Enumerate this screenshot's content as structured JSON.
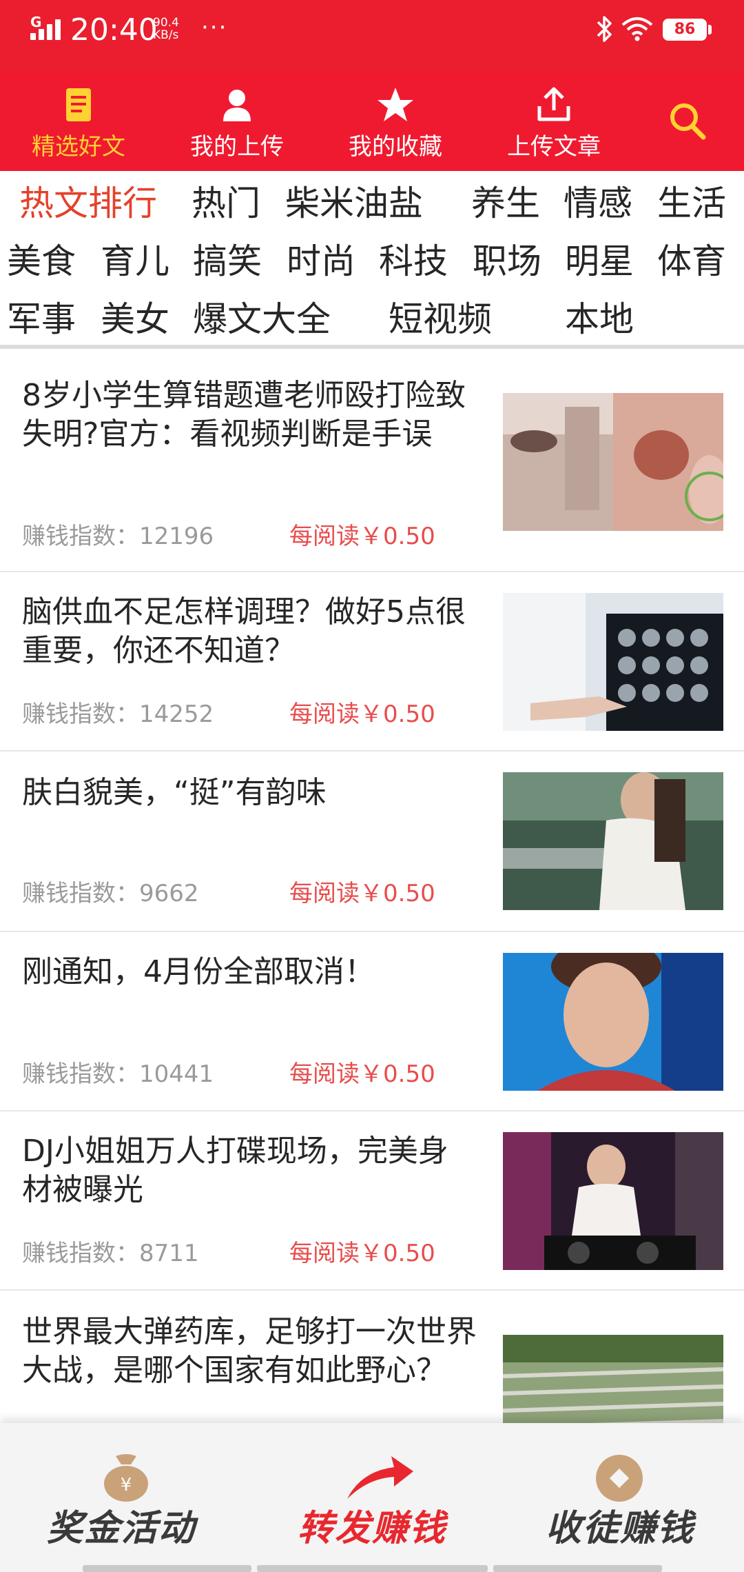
{
  "status_bar": {
    "carrier_mark": "G",
    "time": "20:40",
    "net_speed_value": "90.4",
    "net_speed_unit": "KB/s",
    "more": "···",
    "battery": "86",
    "icons": [
      "signal-icon",
      "bluetooth-icon",
      "wifi-icon",
      "battery-icon"
    ]
  },
  "top_nav": {
    "items": [
      {
        "label": "精选好文",
        "icon": "article-icon",
        "active": true
      },
      {
        "label": "我的上传",
        "icon": "user-icon",
        "active": false
      },
      {
        "label": "我的收藏",
        "icon": "star-icon",
        "active": false
      },
      {
        "label": "上传文章",
        "icon": "upload-icon",
        "active": false
      }
    ],
    "search_icon": "search-icon"
  },
  "categories": [
    "热文排行",
    "热门",
    "柴米油盐",
    "养生",
    "情感",
    "生活",
    "美食",
    "育儿",
    "搞笑",
    "时尚",
    "科技",
    "职场",
    "明星",
    "体育",
    "军事",
    "美女",
    "爆文大全",
    "短视频",
    "本地"
  ],
  "active_category": "热文排行",
  "articles": [
    {
      "title": "8岁小学生算错题遭老师殴打险致失明?官方：看视频判断是手误",
      "index_label": "赚钱指数：",
      "index_value": "12196",
      "reward": "每阅读￥0.50"
    },
    {
      "title": "脑供血不足怎样调理？做好5点很重要，你还不知道？",
      "index_label": "赚钱指数：",
      "index_value": "14252",
      "reward": "每阅读￥0.50"
    },
    {
      "title": "肤白貌美，“挺”有韵味",
      "index_label": "赚钱指数：",
      "index_value": "9662",
      "reward": "每阅读￥0.50"
    },
    {
      "title": "刚通知，4月份全部取消！",
      "index_label": "赚钱指数：",
      "index_value": "10441",
      "reward": "每阅读￥0.50"
    },
    {
      "title": "DJ小姐姐万人打碟现场，完美身材被曝光",
      "index_label": "赚钱指数：",
      "index_value": "8711",
      "reward": "每阅读￥0.50"
    },
    {
      "title": "世界最大弹药库，足够打一次世界大战，是哪个国家有如此野心？",
      "index_label": "",
      "index_value": "",
      "reward": ""
    }
  ],
  "bottom_bar": {
    "items": [
      {
        "label": "奖金活动",
        "icon": "money-bag-icon"
      },
      {
        "label": "转发赚钱",
        "icon": "share-arrow-icon"
      },
      {
        "label": "收徒赚钱",
        "icon": "coin-icon"
      }
    ]
  },
  "colors": {
    "status_bar": "#ea1e2e",
    "nav_bar": "#f01a30",
    "active_nav": "#ffd233",
    "active_category": "#e4412b",
    "reward_text": "#e84c4c",
    "bottom_bar_hot": "#e8282e"
  }
}
